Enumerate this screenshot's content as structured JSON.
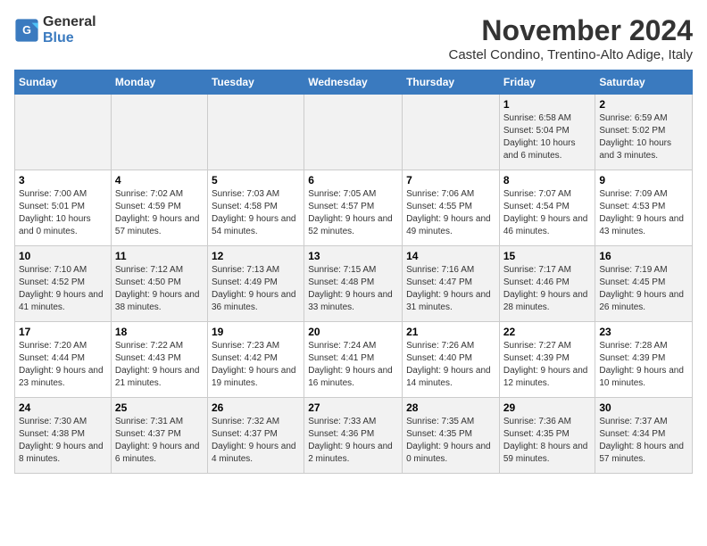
{
  "header": {
    "logo_line1": "General",
    "logo_line2": "Blue",
    "month_year": "November 2024",
    "location": "Castel Condino, Trentino-Alto Adige, Italy"
  },
  "days_of_week": [
    "Sunday",
    "Monday",
    "Tuesday",
    "Wednesday",
    "Thursday",
    "Friday",
    "Saturday"
  ],
  "weeks": [
    [
      {
        "day": "",
        "content": ""
      },
      {
        "day": "",
        "content": ""
      },
      {
        "day": "",
        "content": ""
      },
      {
        "day": "",
        "content": ""
      },
      {
        "day": "",
        "content": ""
      },
      {
        "day": "1",
        "content": "Sunrise: 6:58 AM\nSunset: 5:04 PM\nDaylight: 10 hours and 6 minutes."
      },
      {
        "day": "2",
        "content": "Sunrise: 6:59 AM\nSunset: 5:02 PM\nDaylight: 10 hours and 3 minutes."
      }
    ],
    [
      {
        "day": "3",
        "content": "Sunrise: 7:00 AM\nSunset: 5:01 PM\nDaylight: 10 hours and 0 minutes."
      },
      {
        "day": "4",
        "content": "Sunrise: 7:02 AM\nSunset: 4:59 PM\nDaylight: 9 hours and 57 minutes."
      },
      {
        "day": "5",
        "content": "Sunrise: 7:03 AM\nSunset: 4:58 PM\nDaylight: 9 hours and 54 minutes."
      },
      {
        "day": "6",
        "content": "Sunrise: 7:05 AM\nSunset: 4:57 PM\nDaylight: 9 hours and 52 minutes."
      },
      {
        "day": "7",
        "content": "Sunrise: 7:06 AM\nSunset: 4:55 PM\nDaylight: 9 hours and 49 minutes."
      },
      {
        "day": "8",
        "content": "Sunrise: 7:07 AM\nSunset: 4:54 PM\nDaylight: 9 hours and 46 minutes."
      },
      {
        "day": "9",
        "content": "Sunrise: 7:09 AM\nSunset: 4:53 PM\nDaylight: 9 hours and 43 minutes."
      }
    ],
    [
      {
        "day": "10",
        "content": "Sunrise: 7:10 AM\nSunset: 4:52 PM\nDaylight: 9 hours and 41 minutes."
      },
      {
        "day": "11",
        "content": "Sunrise: 7:12 AM\nSunset: 4:50 PM\nDaylight: 9 hours and 38 minutes."
      },
      {
        "day": "12",
        "content": "Sunrise: 7:13 AM\nSunset: 4:49 PM\nDaylight: 9 hours and 36 minutes."
      },
      {
        "day": "13",
        "content": "Sunrise: 7:15 AM\nSunset: 4:48 PM\nDaylight: 9 hours and 33 minutes."
      },
      {
        "day": "14",
        "content": "Sunrise: 7:16 AM\nSunset: 4:47 PM\nDaylight: 9 hours and 31 minutes."
      },
      {
        "day": "15",
        "content": "Sunrise: 7:17 AM\nSunset: 4:46 PM\nDaylight: 9 hours and 28 minutes."
      },
      {
        "day": "16",
        "content": "Sunrise: 7:19 AM\nSunset: 4:45 PM\nDaylight: 9 hours and 26 minutes."
      }
    ],
    [
      {
        "day": "17",
        "content": "Sunrise: 7:20 AM\nSunset: 4:44 PM\nDaylight: 9 hours and 23 minutes."
      },
      {
        "day": "18",
        "content": "Sunrise: 7:22 AM\nSunset: 4:43 PM\nDaylight: 9 hours and 21 minutes."
      },
      {
        "day": "19",
        "content": "Sunrise: 7:23 AM\nSunset: 4:42 PM\nDaylight: 9 hours and 19 minutes."
      },
      {
        "day": "20",
        "content": "Sunrise: 7:24 AM\nSunset: 4:41 PM\nDaylight: 9 hours and 16 minutes."
      },
      {
        "day": "21",
        "content": "Sunrise: 7:26 AM\nSunset: 4:40 PM\nDaylight: 9 hours and 14 minutes."
      },
      {
        "day": "22",
        "content": "Sunrise: 7:27 AM\nSunset: 4:39 PM\nDaylight: 9 hours and 12 minutes."
      },
      {
        "day": "23",
        "content": "Sunrise: 7:28 AM\nSunset: 4:39 PM\nDaylight: 9 hours and 10 minutes."
      }
    ],
    [
      {
        "day": "24",
        "content": "Sunrise: 7:30 AM\nSunset: 4:38 PM\nDaylight: 9 hours and 8 minutes."
      },
      {
        "day": "25",
        "content": "Sunrise: 7:31 AM\nSunset: 4:37 PM\nDaylight: 9 hours and 6 minutes."
      },
      {
        "day": "26",
        "content": "Sunrise: 7:32 AM\nSunset: 4:37 PM\nDaylight: 9 hours and 4 minutes."
      },
      {
        "day": "27",
        "content": "Sunrise: 7:33 AM\nSunset: 4:36 PM\nDaylight: 9 hours and 2 minutes."
      },
      {
        "day": "28",
        "content": "Sunrise: 7:35 AM\nSunset: 4:35 PM\nDaylight: 9 hours and 0 minutes."
      },
      {
        "day": "29",
        "content": "Sunrise: 7:36 AM\nSunset: 4:35 PM\nDaylight: 8 hours and 59 minutes."
      },
      {
        "day": "30",
        "content": "Sunrise: 7:37 AM\nSunset: 4:34 PM\nDaylight: 8 hours and 57 minutes."
      }
    ]
  ]
}
